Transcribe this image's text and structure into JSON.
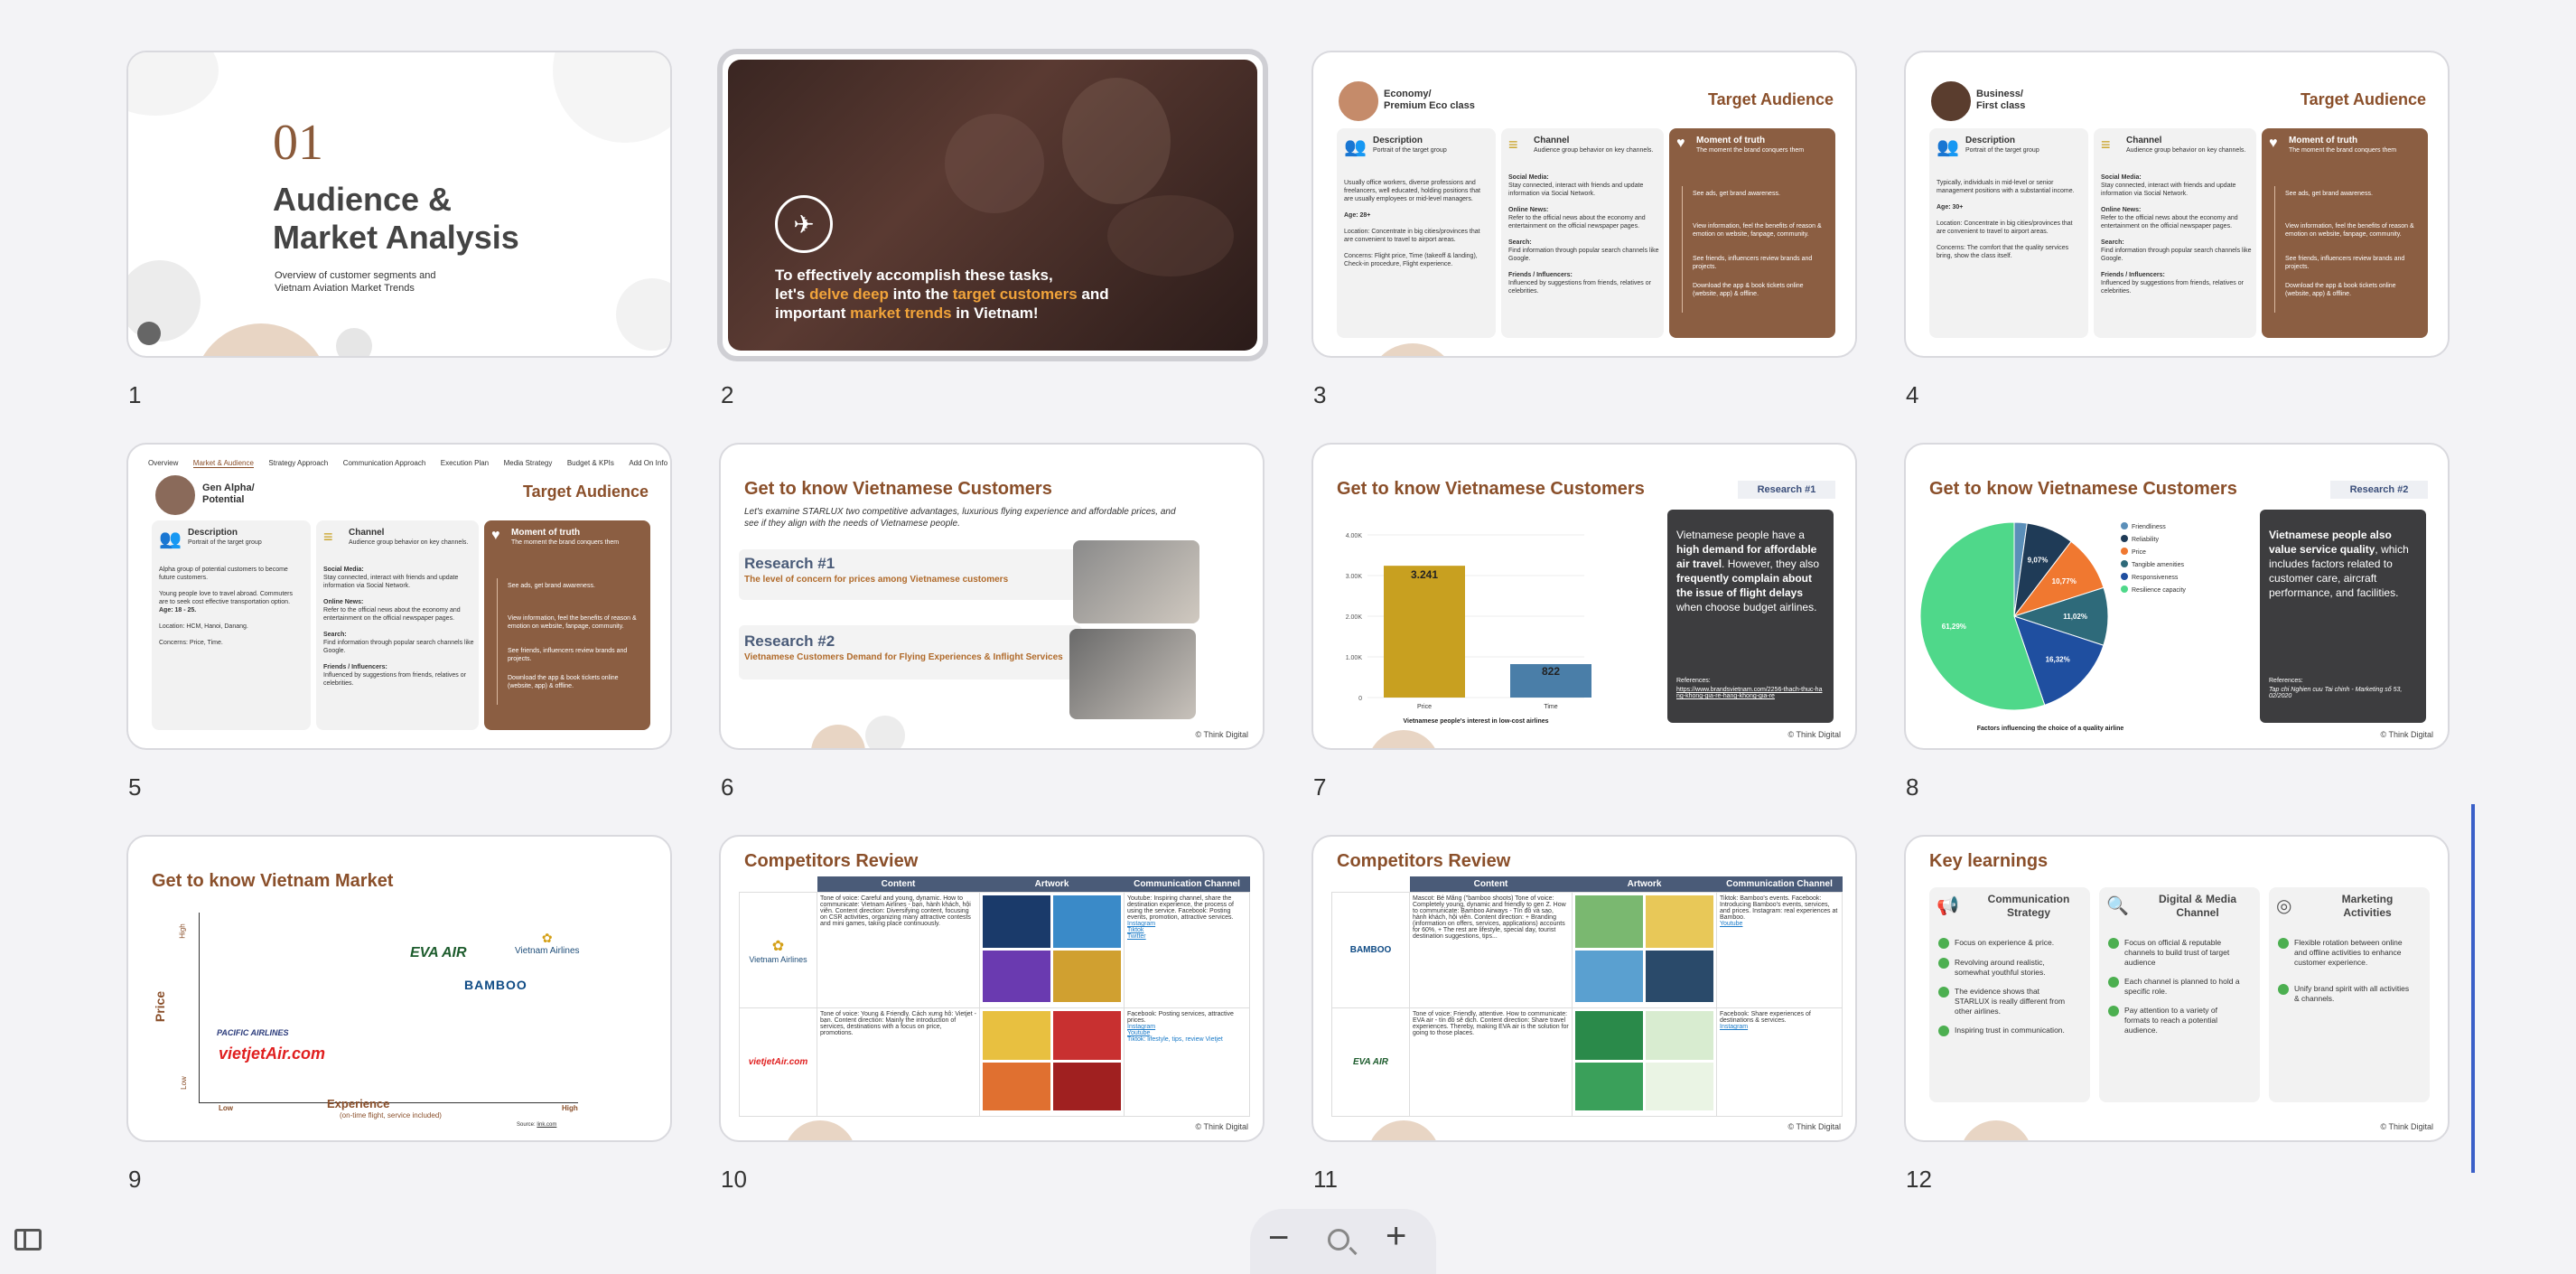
{
  "slides": [
    {
      "number": "1",
      "heading_number": "01",
      "title_line1": "Audience &",
      "title_line2": "Market Analysis",
      "subtitle_line1": "Overview of customer segments and",
      "subtitle_line2": "Vietnam Aviation Market Trends"
    },
    {
      "number": "2",
      "text_line1": "To effectively accomplish these tasks,",
      "text_line2_a": "let's ",
      "text_line2_b": "delve deep",
      "text_line2_c": " into the ",
      "text_line2_d": "target customers",
      "text_line2_e": " and",
      "text_line3_a": "important ",
      "text_line3_b": "market trends",
      "text_line3_c": " in Vietnam!"
    },
    {
      "number": "3",
      "segment_line1": "Economy/",
      "segment_line2": "Premium Eco class",
      "title": "Target Audience",
      "desc_title": "Description",
      "desc_sub": "Portrait of the target group",
      "desc_body": "Usually office workers, diverse professions and freelancers, well educated, holding positions that are usually employees or mid-level managers.",
      "age": "Age: 28+",
      "location": "Location: Concentrate in big cities/provinces that are convenient to travel to airport areas.",
      "concerns": "Concerns: Flight price, Time (takeoff & landing), Check-in procedure, Flight experience.",
      "channel_title": "Channel",
      "channel_sub": "Audience group behavior on key channels.",
      "social": "Social Media:",
      "social_body": "Stay connected, interact with friends and update information via Social Network.",
      "news": "Online News:",
      "news_body": "Refer to the official news about the economy and entertainment on the official newspaper pages.",
      "search": "Search:",
      "search_body": "Find information through popular search channels like Google.",
      "friends": "Friends / Influencers:",
      "friends_body": "Influenced by suggestions from friends, relatives or celebrities.",
      "moment_title": "Moment of truth",
      "moment_sub": "The moment the brand conquers them",
      "m1": "See ads, get brand awareness.",
      "m2": "View information, feel the benefits of reason & emotion on website, fanpage, community.",
      "m3": "See friends, influencers review brands and projects.",
      "m4": "Download the app & book tickets online (website, app) & offline."
    },
    {
      "number": "4",
      "segment_line1": "Business/",
      "segment_line2": "First class",
      "title": "Target Audience",
      "desc_title": "Description",
      "desc_sub": "Portrait of the target group",
      "desc_body": "Typically, individuals in mid-level or senior management positions with a substantial income.",
      "age": "Age: 30+",
      "location": "Location: Concentrate in big cities/provinces that are convenient to travel to airport areas.",
      "concerns": "Concerns: The comfort that the quality services bring, show the class itself.",
      "channel_title": "Channel",
      "channel_sub": "Audience group behavior on key channels.",
      "social": "Social Media:",
      "social_body": "Stay connected, interact with friends and update information via Social Network.",
      "news": "Online News:",
      "news_body": "Refer to the official news about the economy and entertainment on the official newspaper pages.",
      "search": "Search:",
      "search_body": "Find information through popular search channels like Google.",
      "friends": "Friends / Influencers:",
      "friends_body": "Influenced by suggestions from friends, relatives or celebrities.",
      "moment_title": "Moment of truth",
      "moment_sub": "The moment the brand conquers them",
      "m1": "See ads, get brand awareness.",
      "m2": "View information, feel the benefits of reason & emotion on website, fanpage, community.",
      "m3": "See friends, influencers review brands and projects.",
      "m4": "Download the app & book tickets online (website, app) & offline."
    },
    {
      "number": "5",
      "tabs": [
        "Overview",
        "Market & Audience",
        "Strategy Approach",
        "Communication Approach",
        "Execution Plan",
        "Media Strategy",
        "Budget & KPIs",
        "Add On Info"
      ],
      "segment_line1": "Gen Alpha/",
      "segment_line2": "Potential",
      "title": "Target Audience",
      "desc_title": "Description",
      "desc_sub": "Portrait of the target group",
      "desc_body": "Alpha group of potential customers to become future customers.",
      "desc_body2": "Young people love to travel abroad. Commuters are to seek cost effective transportation option.",
      "age": "Age: 18 - 25.",
      "location": "Location: HCM, Hanoi, Danang.",
      "concerns": "Concerns: Price, Time.",
      "channel_title": "Channel",
      "channel_sub": "Audience group behavior on key channels.",
      "social": "Social Media:",
      "social_body": "Stay connected, interact with friends and update information via Social Network.",
      "news": "Online News:",
      "news_body": "Refer to the official news about the economy and entertainment on the official newspaper pages.",
      "search": "Search:",
      "search_body": "Find information through popular search channels like Google.",
      "friends": "Friends / Influencers:",
      "friends_body": "Influenced by suggestions from friends, relatives or celebrities.",
      "moment_title": "Moment of truth",
      "moment_sub": "The moment the brand conquers them",
      "m1": "See ads, get brand awareness.",
      "m2": "View information, feel the benefits of reason & emotion on website, fanpage, community.",
      "m3": "See friends, influencers review brands and projects.",
      "m4": "Download the app & book tickets online (website, app) & offline."
    },
    {
      "number": "6",
      "title": "Get to know Vietnamese Customers",
      "intro": "Let's examine STARLUX two competitive advantages, luxurious flying experience and affordable prices, and see if they align with the needs of Vietnamese people.",
      "r1_title": "Research #1",
      "r1_sub": "The level of concern for prices among Vietnamese customers",
      "r2_title": "Research #2",
      "r2_sub": "Vietnamese Customers Demand for Flying Experiences & Inflight Services",
      "credit": "© Think Digital"
    },
    {
      "number": "7",
      "title": "Get to know Vietnamese Customers",
      "badge": "Research #1",
      "box_a": "Vietnamese people have a ",
      "box_b": "high demand for affordable air travel",
      "box_c": ". However, they also ",
      "box_d": "frequently complain about the issue of flight delays",
      "box_e": " when choose budget airlines.",
      "ref_label": "References:",
      "ref_url": "https://www.brandsvietnam.com/2256-thach-thuc-hang-khong-gia-re-hang-khong-gia-re",
      "credit": "© Think Digital"
    },
    {
      "number": "8",
      "title": "Get to know Vietnamese Customers",
      "badge": "Research #2",
      "box_a": "Vietnamese people also value service quality",
      "box_b": ", which includes factors related to customer care, aircraft performance, and facilities.",
      "ref_label": "References:",
      "ref_body": "Tap chi Nghien cuu Tai chinh - Marketing số 53, 02/2020",
      "credit": "© Think Digital"
    },
    {
      "number": "9",
      "title": "Get to know Vietnam Market",
      "y_label": "Price",
      "y_high": "High",
      "y_low": "Low",
      "x_label": "Experience",
      "x_sub": "(on-time flight, service included)",
      "x_low": "Low",
      "x_high": "High",
      "source": "Source: ",
      "source_link": "link.com",
      "brands": [
        "Vietnam Airlines",
        "EVA AIR",
        "BAMBOO",
        "PACIFIC AIRLINES",
        "vietjetAir.com"
      ]
    },
    {
      "number": "10",
      "title": "Competitors Review",
      "cols": [
        "Content",
        "Artwork",
        "Communication Channel"
      ],
      "row1_logo": "Vietnam Airlines",
      "row1_content": "Tone of voice: Careful and young, dynamic. How to communicate: Vietnam Airlines - bạn, hành khách, hội viên. Content direction: Diversifying content, focusing on CSR activities, organizing many attractive contests and mini games, taking place continuously.",
      "row1_channel": "Youtube: Inspiring channel, share the destination experience, the process of using the service. Facebook: Posting events, promotion, attractive services.",
      "row1_links": [
        "Instagram",
        "Tiktok",
        "Twitter"
      ],
      "row2_logo": "vietjetAir.com",
      "row2_content": "Tone of voice: Young & Friendly. Cách xưng hô: Vietjet - bạn. Content direction: Mainly the introduction of services, destinations with a focus on price, promotions.",
      "row2_channel": "Facebook: Posting services, attractive prices.",
      "row2_links": [
        "Instagram",
        "Youtube",
        "Tiktok: lifestyle, tips, review Vietjet"
      ],
      "credit": "© Think Digital"
    },
    {
      "number": "11",
      "title": "Competitors Review",
      "cols": [
        "Content",
        "Artwork",
        "Communication Channel"
      ],
      "row1_logo": "BAMBOO",
      "row1_content": "Mascot: Bé Măng (\"bamboo shoots) Tone of voice: Completely young, dynamic and friendly to gen Z. How to communicate: Bamboo Airways - Tín đồ và sao, hành khách, hội viên. Content direction: + Branding (information on offers, services, applications) accounts for 60%. + The rest are lifestyle, special day, tourist destination suggestions, tips...",
      "row1_channel": "Tiktok: Bamboo's events. Facebook: Introducing Bamboo's events, services, and prices. Instagram: real experiences at Bamboo.",
      "row1_links": [
        "Youtube"
      ],
      "row2_logo": "EVA AIR",
      "row2_content": "Tone of voice: Friendly, attentive. How to communicate: EVA air - tín đồ sẽ dịch. Content direction: Share travel experiences. Thereby, making EVA air is the solution for going to those places.",
      "row2_channel": "Facebook: Share experiences of destinations & services.",
      "row2_links": [
        "Instagram"
      ],
      "credit": "© Think Digital"
    },
    {
      "number": "12",
      "title": "Key learnings",
      "col1_title_1": "Communication",
      "col1_title_2": "Strategy",
      "col1_items": [
        "Focus on experience & price.",
        "Revolving around realistic, somewhat youthful stories.",
        "The evidence shows that STARLUX is really different from other airlines.",
        "Inspiring trust in communication."
      ],
      "col2_title_1": "Digital & Media",
      "col2_title_2": "Channel",
      "col2_items": [
        "Focus on official & reputable channels to build trust of target audience",
        "Each channel is planned to hold a specific role.",
        "Pay attention to a variety of formats to reach a potential audience."
      ],
      "col3_title_1": "Marketing",
      "col3_title_2": "Activities",
      "col3_items": [
        "Flexible rotation between online and offline activities to enhance customer experience.",
        "Unify brand spirit with all activities & channels."
      ],
      "credit": "© Think Digital"
    }
  ],
  "chart7": {
    "type": "bar",
    "categories": [
      "Price",
      "Time"
    ],
    "values": [
      3.241,
      822
    ],
    "value_labels": [
      "3.241",
      "822"
    ],
    "ticks": [
      "4.00K",
      "3.00K",
      "2.00K",
      "1.00K",
      "0"
    ],
    "ylim": [
      0,
      4000
    ],
    "xlabel": "Vietnamese people's interest in low-cost airlines",
    "colors": [
      "#c8a020",
      "#4a7ea8"
    ]
  },
  "chart8": {
    "type": "pie",
    "categories": [
      "Friendliness",
      "Reliability",
      "Price",
      "Tangible amenities",
      "Responsiveness",
      "Resilience capacity"
    ],
    "values": [
      2.43,
      9.07,
      10.77,
      11.02,
      16.32,
      61.29
    ],
    "value_labels": [
      "",
      "9,07%",
      "10,77%",
      "11,02%",
      "16,32%",
      "61,29%"
    ],
    "colors": [
      "#5b8fb9",
      "#1f3b57",
      "#f07830",
      "#2e6a7a",
      "#1f4fa0",
      "#4fd88a"
    ],
    "xlabel": "Factors influencing the choice of a quality airline"
  },
  "ui": {
    "zoom_out": "−",
    "zoom_icon": "zoom-icon",
    "zoom_in": "+",
    "panel_icon": "panel-icon"
  }
}
